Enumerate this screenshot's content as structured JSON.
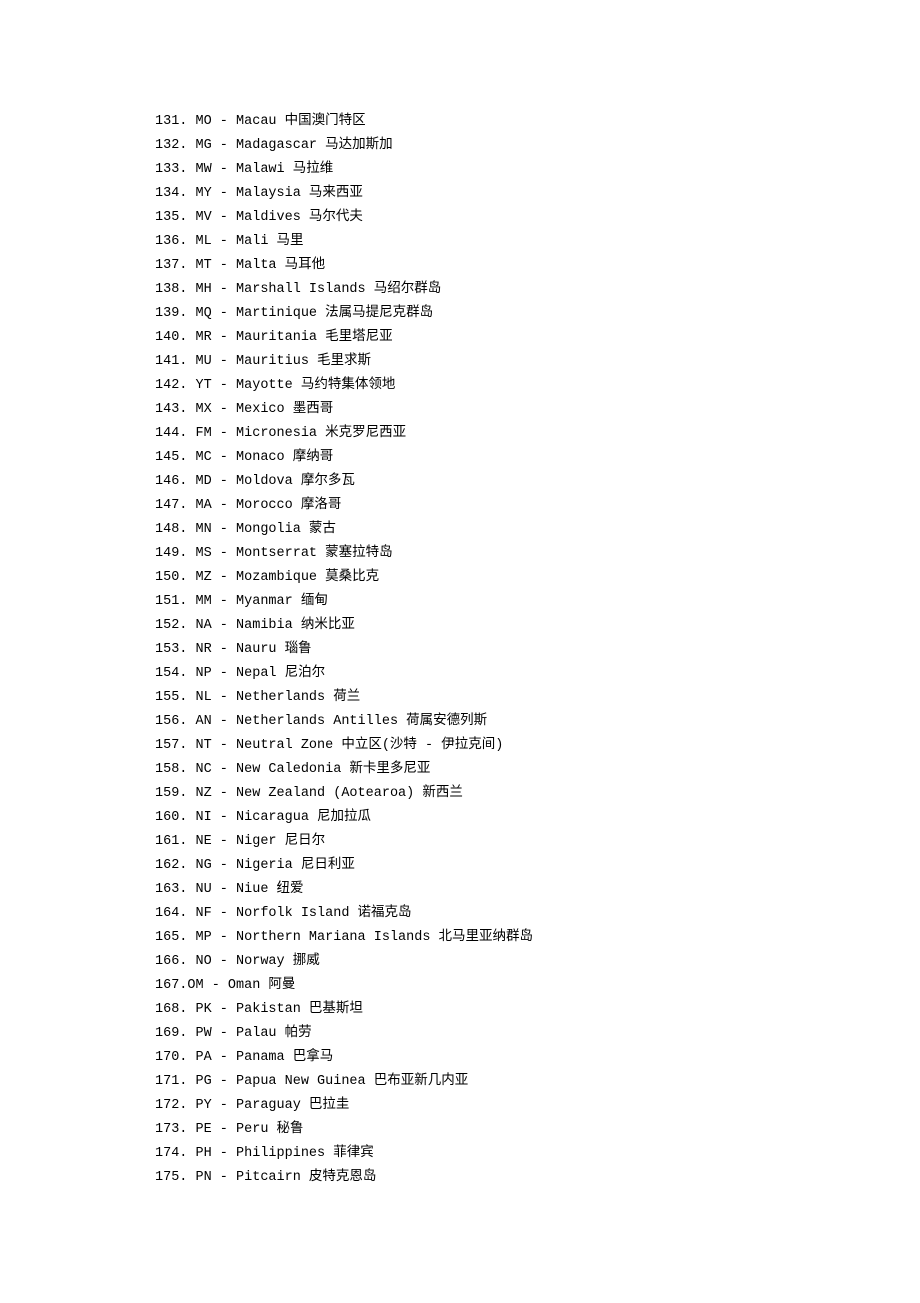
{
  "entries": [
    {
      "num": "131",
      "code": "MO",
      "sep": " - ",
      "name_en": "Macau",
      "name_zh": "中国澳门特区"
    },
    {
      "num": "132",
      "code": "MG",
      "sep": " - ",
      "name_en": "Madagascar",
      "name_zh": "马达加斯加"
    },
    {
      "num": "133",
      "code": "MW",
      "sep": " - ",
      "name_en": "Malawi",
      "name_zh": "马拉维"
    },
    {
      "num": "134",
      "code": "MY",
      "sep": " - ",
      "name_en": "Malaysia",
      "name_zh": "马来西亚"
    },
    {
      "num": "135",
      "code": "MV",
      "sep": " - ",
      "name_en": "Maldives",
      "name_zh": "马尔代夫"
    },
    {
      "num": "136",
      "code": "ML",
      "sep": " - ",
      "name_en": "Mali",
      "name_zh": "马里"
    },
    {
      "num": "137",
      "code": "MT",
      "sep": " - ",
      "name_en": "Malta",
      "name_zh": "马耳他"
    },
    {
      "num": "138",
      "code": "MH",
      "sep": " - ",
      "name_en": "Marshall Islands",
      "name_zh": "马绍尔群岛"
    },
    {
      "num": "139",
      "code": "MQ",
      "sep": " - ",
      "name_en": "Martinique",
      "name_zh": "法属马提尼克群岛"
    },
    {
      "num": "140",
      "code": "MR",
      "sep": " - ",
      "name_en": "Mauritania",
      "name_zh": "毛里塔尼亚"
    },
    {
      "num": "141",
      "code": "MU",
      "sep": " - ",
      "name_en": "Mauritius",
      "name_zh": "毛里求斯"
    },
    {
      "num": "142",
      "code": "YT",
      "sep": " - ",
      "name_en": "Mayotte",
      "name_zh": "马约特集体领地"
    },
    {
      "num": "143",
      "code": "MX",
      "sep": " - ",
      "name_en": "Mexico",
      "name_zh": "墨西哥"
    },
    {
      "num": "144",
      "code": "FM",
      "sep": " - ",
      "name_en": "Micronesia",
      "name_zh": "米克罗尼西亚"
    },
    {
      "num": "145",
      "code": "MC",
      "sep": " - ",
      "name_en": "Monaco",
      "name_zh": "摩纳哥"
    },
    {
      "num": "146",
      "code": "MD",
      "sep": " - ",
      "name_en": "Moldova",
      "name_zh": "摩尔多瓦"
    },
    {
      "num": "147",
      "code": "MA",
      "sep": " - ",
      "name_en": "Morocco",
      "name_zh": "摩洛哥"
    },
    {
      "num": "148",
      "code": "MN",
      "sep": " - ",
      "name_en": "Mongolia",
      "name_zh": "蒙古"
    },
    {
      "num": "149",
      "code": "MS",
      "sep": " - ",
      "name_en": "Montserrat",
      "name_zh": "蒙塞拉特岛"
    },
    {
      "num": "150",
      "code": "MZ",
      "sep": " - ",
      "name_en": "Mozambique",
      "name_zh": "莫桑比克"
    },
    {
      "num": "151",
      "code": "MM",
      "sep": " - ",
      "name_en": "Myanmar",
      "name_zh": "缅甸"
    },
    {
      "num": "152",
      "code": "NA",
      "sep": " - ",
      "name_en": "Namibia",
      "name_zh": "纳米比亚"
    },
    {
      "num": "153",
      "code": "NR",
      "sep": " - ",
      "name_en": "Nauru",
      "name_zh": "瑙鲁"
    },
    {
      "num": "154",
      "code": "NP",
      "sep": " - ",
      "name_en": "Nepal",
      "name_zh": "尼泊尔"
    },
    {
      "num": "155",
      "code": "NL",
      "sep": " - ",
      "name_en": "Netherlands",
      "name_zh": "荷兰"
    },
    {
      "num": "156",
      "code": "AN",
      "sep": " - ",
      "name_en": "Netherlands Antilles",
      "name_zh": "荷属安德列斯"
    },
    {
      "num": "157",
      "code": "NT",
      "sep": " - ",
      "name_en": "Neutral Zone",
      "name_zh": "中立区(沙特 - 伊拉克间)"
    },
    {
      "num": "158",
      "code": "NC",
      "sep": " - ",
      "name_en": "New Caledonia",
      "name_zh": "新卡里多尼亚"
    },
    {
      "num": "159",
      "code": "NZ",
      "sep": " - ",
      "name_en": "New Zealand (Aotearoa)",
      "name_zh": "新西兰"
    },
    {
      "num": "160",
      "code": "NI",
      "sep": " - ",
      "name_en": "Nicaragua",
      "name_zh": "尼加拉瓜"
    },
    {
      "num": "161",
      "code": "NE",
      "sep": " - ",
      "name_en": "Niger",
      "name_zh": "尼日尔"
    },
    {
      "num": "162",
      "code": "NG",
      "sep": " - ",
      "name_en": "Nigeria",
      "name_zh": "尼日利亚"
    },
    {
      "num": "163",
      "code": "NU",
      "sep": " - ",
      "name_en": "Niue",
      "name_zh": "纽爱"
    },
    {
      "num": "164",
      "code": "NF",
      "sep": " - ",
      "name_en": "Norfolk Island",
      "name_zh": "诺福克岛"
    },
    {
      "num": "165",
      "code": "MP",
      "sep": " - ",
      "name_en": "Northern Mariana Islands",
      "name_zh": "北马里亚纳群岛"
    },
    {
      "num": "166",
      "code": "NO",
      "sep": " - ",
      "name_en": "Norway",
      "name_zh": "挪威"
    },
    {
      "num": "167",
      "code": "OM",
      "sep": " - ",
      "name_en": "Oman",
      "name_zh": "阿曼",
      "tight": true
    },
    {
      "num": "168",
      "code": "PK",
      "sep": " - ",
      "name_en": "Pakistan",
      "name_zh": "巴基斯坦"
    },
    {
      "num": "169",
      "code": "PW",
      "sep": " - ",
      "name_en": "Palau",
      "name_zh": "帕劳"
    },
    {
      "num": "170",
      "code": "PA",
      "sep": " - ",
      "name_en": "Panama",
      "name_zh": "巴拿马"
    },
    {
      "num": "171",
      "code": "PG",
      "sep": " - ",
      "name_en": "Papua New Guinea",
      "name_zh": "巴布亚新几内亚"
    },
    {
      "num": "172",
      "code": "PY",
      "sep": " - ",
      "name_en": "Paraguay",
      "name_zh": "巴拉圭"
    },
    {
      "num": "173",
      "code": "PE",
      "sep": " - ",
      "name_en": "Peru",
      "name_zh": "秘鲁"
    },
    {
      "num": "174",
      "code": "PH",
      "sep": " - ",
      "name_en": "Philippines",
      "name_zh": "菲律宾"
    },
    {
      "num": "175",
      "code": "PN",
      "sep": " - ",
      "name_en": "Pitcairn",
      "name_zh": "皮特克恩岛"
    }
  ]
}
